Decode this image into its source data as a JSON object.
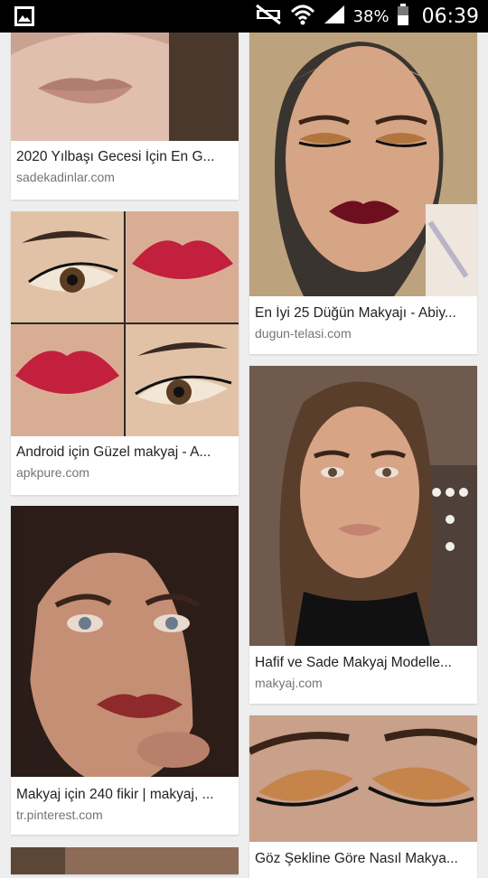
{
  "status_bar": {
    "battery_percent": "38%",
    "time": "06:39",
    "icons": [
      "image-notification-icon",
      "mute-icon",
      "wifi-icon",
      "signal-icon",
      "battery-icon"
    ]
  },
  "results": [
    {
      "title": "2020 Yılbaşı Gecesi İçin En G...",
      "source": "sadekadinlar.com"
    },
    {
      "title": "Android için Güzel makyaj - A...",
      "source": "apkpure.com"
    },
    {
      "title": "Makyaj için 240 fikir | makyaj, ...",
      "source": "tr.pinterest.com"
    },
    {
      "title": "En İyi 25 Düğün Makyajı - Abiy...",
      "source": "dugun-telasi.com"
    },
    {
      "title": "Hafif ve Sade Makyaj Modelle...",
      "source": "makyaj.com"
    },
    {
      "title": "Göz Şekline Göre Nasıl Makya...",
      "source": ""
    }
  ]
}
